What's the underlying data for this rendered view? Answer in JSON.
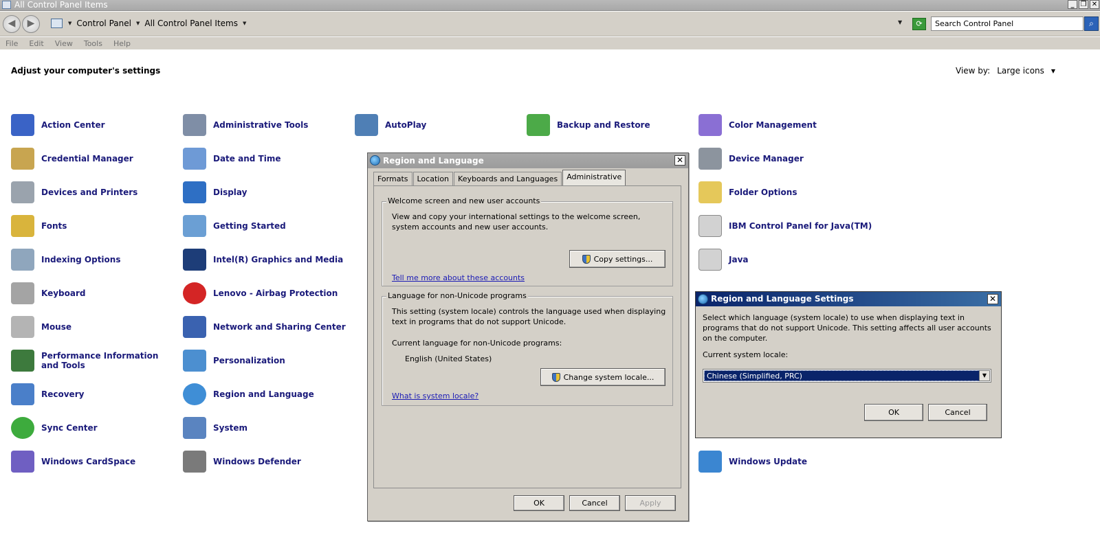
{
  "window": {
    "title": "All Control Panel Items"
  },
  "window_buttons": [
    "_",
    "❐",
    "✕"
  ],
  "address": {
    "crumbs": [
      "Control Panel",
      "All Control Panel Items"
    ],
    "search_placeholder": "Search Control Panel"
  },
  "menu": [
    "File",
    "Edit",
    "View",
    "Tools",
    "Help"
  ],
  "header": {
    "title": "Adjust your computer's settings",
    "view_by_label": "View by:",
    "view_by_value": "Large icons"
  },
  "items": [
    {
      "label": "Action Center",
      "icon": "flag-icon",
      "color": "#3a63c6"
    },
    {
      "label": "Administrative Tools",
      "icon": "gears-icon",
      "color": "#7f8ea6"
    },
    {
      "label": "AutoPlay",
      "icon": "autoplay-icon",
      "color": "#4f7fb5"
    },
    {
      "label": "Backup and Restore",
      "icon": "backup-icon",
      "color": "#4caa48"
    },
    {
      "label": "Color Management",
      "icon": "color-monitor-icon",
      "color": "#8a6fd4"
    },
    {
      "label": "Credential Manager",
      "icon": "vault-icon",
      "color": "#c8a550"
    },
    {
      "label": "Date and Time",
      "icon": "clock-calendar-icon",
      "color": "#6e9ad6"
    },
    {
      "label": "Device Manager",
      "icon": "device-manager-icon",
      "color": "#8c949e"
    },
    {
      "label": "Devices and Printers",
      "icon": "printer-icon",
      "color": "#9aa3ad"
    },
    {
      "label": "Display",
      "icon": "display-icon",
      "color": "#2e6fc4"
    },
    {
      "label": "Folder Options",
      "icon": "folder-icon",
      "color": "#e5c85a"
    },
    {
      "label": "Fonts",
      "icon": "fonts-icon",
      "color": "#d9b43c"
    },
    {
      "label": "Getting Started",
      "icon": "getting-started-icon",
      "color": "#6b9fd4"
    },
    {
      "label": "IBM Control Panel for Java(TM)",
      "icon": "java-icon",
      "color": "#d2d2d2"
    },
    {
      "label": "Indexing Options",
      "icon": "magnifier-icon",
      "color": "#8fa6bd"
    },
    {
      "label": "Intel(R) Graphics and Media",
      "icon": "intel-graphics-icon",
      "color": "#1d3d78"
    },
    {
      "label": "Java",
      "icon": "java-icon",
      "color": "#d2d2d2"
    },
    {
      "label": "Keyboard",
      "icon": "keyboard-icon",
      "color": "#a4a4a4"
    },
    {
      "label": "Lenovo - Airbag Protection",
      "icon": "lenovo-airbag-icon",
      "color": "#d42525"
    },
    {
      "label": "Mouse",
      "icon": "mouse-icon",
      "color": "#b4b4b4"
    },
    {
      "label": "Network and Sharing Center",
      "icon": "network-icon",
      "color": "#3a62b0"
    },
    {
      "label": "Performance Information and Tools",
      "icon": "performance-icon",
      "color": "#3d7a3d"
    },
    {
      "label": "Personalization",
      "icon": "personalization-icon",
      "color": "#4c8fd0"
    },
    {
      "label": "Recovery",
      "icon": "recovery-icon",
      "color": "#4a7fc9"
    },
    {
      "label": "Region and Language",
      "icon": "globe-clock-icon",
      "color": "#3f8ed6"
    },
    {
      "label": "Sync Center",
      "icon": "sync-icon",
      "color": "#3dab3d"
    },
    {
      "label": "System",
      "icon": "system-icon",
      "color": "#5a84c0"
    },
    {
      "label": "Windows CardSpace",
      "icon": "cardspace-icon",
      "color": "#6f5fc2"
    },
    {
      "label": "Windows Defender",
      "icon": "defender-icon",
      "color": "#7a7a7a"
    },
    {
      "label": "Windows Update",
      "icon": "windows-update-icon",
      "color": "#3b86d1"
    }
  ],
  "region_dialog": {
    "title": "Region and Language",
    "tabs": [
      "Formats",
      "Location",
      "Keyboards and Languages",
      "Administrative"
    ],
    "active_tab": "Administrative",
    "welcome_group": {
      "legend": "Welcome screen and new user accounts",
      "text": "View and copy your international settings to the welcome screen, system accounts and new user accounts.",
      "button": "Copy settings...",
      "link": "Tell me more about these accounts"
    },
    "unicode_group": {
      "legend": "Language for non-Unicode programs",
      "text": "This setting (system locale) controls the language used when displaying text in programs that do not support Unicode.",
      "current_label": "Current language for non-Unicode programs:",
      "current_value": "English (United States)",
      "button": "Change system locale...",
      "link": "What is system locale?"
    },
    "buttons": {
      "ok": "OK",
      "cancel": "Cancel",
      "apply": "Apply"
    }
  },
  "settings_dialog": {
    "title": "Region and Language Settings",
    "text": "Select which language (system locale) to use when displaying text in programs that do not support Unicode. This setting affects all user accounts on the computer.",
    "locale_label": "Current system locale:",
    "locale_value": "Chinese (Simplified, PRC)",
    "buttons": {
      "ok": "OK",
      "cancel": "Cancel"
    }
  }
}
